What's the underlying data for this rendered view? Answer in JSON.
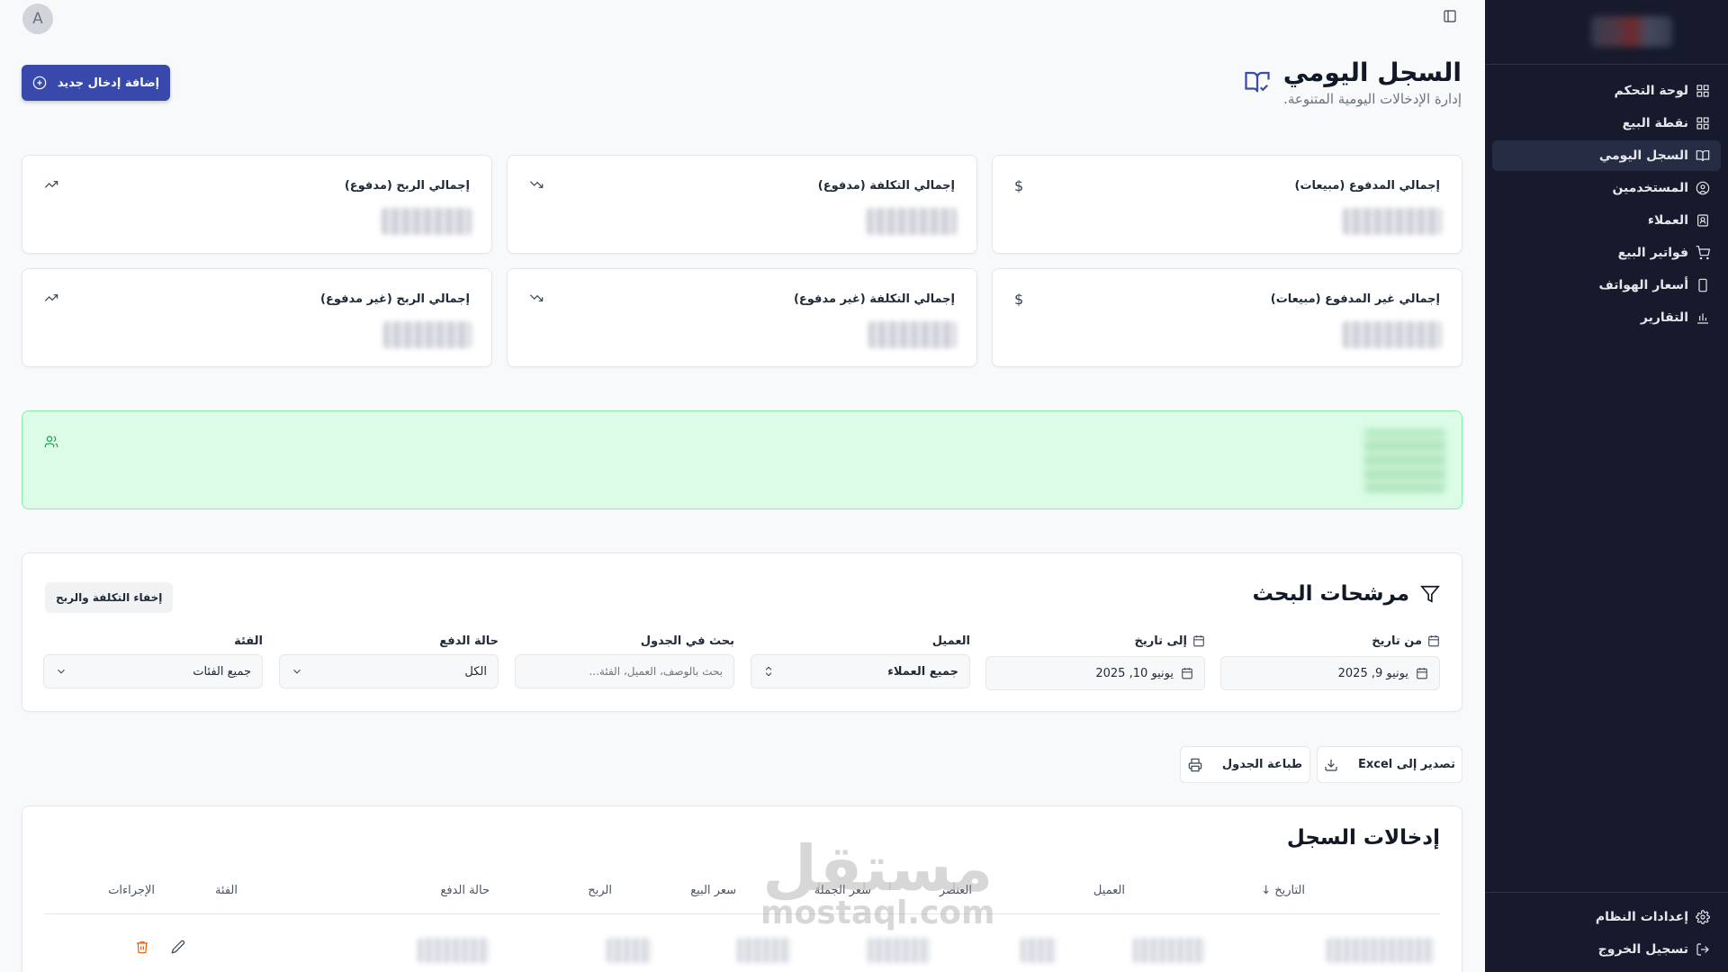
{
  "user": {
    "avatar_letter": "A"
  },
  "sidebar": {
    "items": [
      {
        "label": "لوحة التحكم",
        "icon": "dashboard-grid-icon",
        "active": false
      },
      {
        "label": "نقطة البيع",
        "icon": "pos-grid-icon",
        "active": false
      },
      {
        "label": "السجل اليومي",
        "icon": "book-check-icon",
        "active": true
      },
      {
        "label": "المستخدمين",
        "icon": "user-circle-icon",
        "active": false
      },
      {
        "label": "العملاء",
        "icon": "contact-icon",
        "active": false
      },
      {
        "label": "فواتير البيع",
        "icon": "cart-icon",
        "active": false
      },
      {
        "label": "أسعار الهواتف",
        "icon": "phone-icon",
        "active": false
      },
      {
        "label": "التقارير",
        "icon": "bar-chart-icon",
        "active": false
      }
    ],
    "bottom": [
      {
        "label": "إعدادات النظام",
        "icon": "gear-icon"
      },
      {
        "label": "تسجيل الخروج",
        "icon": "logout-icon"
      }
    ]
  },
  "header": {
    "title": "السجل اليومي",
    "subtitle": "إدارة الإدخالات اليومية المتنوعة.",
    "add_button": "إضافة إدخال جديد"
  },
  "stats": [
    {
      "title": "إجمالي المدفوع (مبيعات)",
      "icon": "dollar-icon"
    },
    {
      "title": "إجمالي التكلفة (مدفوع)",
      "icon": "trending-down-icon"
    },
    {
      "title": "إجمالي الربح (مدفوع)",
      "icon": "trending-up-icon"
    },
    {
      "title": "إجمالي غير المدفوع (مبيعات)",
      "icon": "dollar-icon"
    },
    {
      "title": "إجمالي التكلفة (غير مدفوع)",
      "icon": "trending-down-icon"
    },
    {
      "title": "إجمالي الربح (غير مدفوع)",
      "icon": "trending-up-icon"
    }
  ],
  "filters": {
    "title": "مرشحات البحث",
    "toggle_button": "إخفاء التكلفة والربح",
    "from_date": {
      "label": "من تاريخ",
      "value": "يونيو 9, 2025"
    },
    "to_date": {
      "label": "إلى تاريخ",
      "value": "يونيو 10, 2025"
    },
    "customer": {
      "label": "العميل",
      "value": "جميع العملاء"
    },
    "search": {
      "label": "بحث في الجدول",
      "placeholder": "بحث بالوصف، العميل، الفئة..."
    },
    "payment_status": {
      "label": "حالة الدفع",
      "value": "الكل"
    },
    "category": {
      "label": "الفئة",
      "value": "جميع الفئات"
    }
  },
  "actions": {
    "export_excel": "تصدير إلى Excel",
    "print_table": "طباعة الجدول"
  },
  "table": {
    "title": "إدخالات السجل",
    "columns": [
      "التاريخ",
      "العميل",
      "العنصر",
      "سعر الجملة",
      "سعر البيع",
      "الربح",
      "حالة الدفع",
      "الفئة",
      "الإجراءات"
    ]
  },
  "watermark": {
    "arabic": "مستقل",
    "latin": "mostaql.com"
  },
  "colors": {
    "sidebar_bg": "#161a2c",
    "primary": "#3949ab",
    "success_bg": "#dcfce7",
    "danger": "#ea580c"
  }
}
